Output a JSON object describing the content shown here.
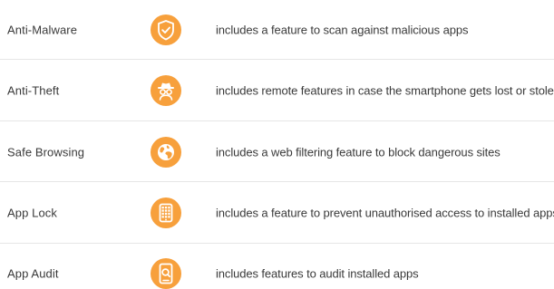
{
  "features": [
    {
      "name": "Anti-Malware",
      "icon": "shield-check-icon",
      "description": "includes a feature to scan against malicious apps"
    },
    {
      "name": "Anti-Theft",
      "icon": "incognito-spy-icon",
      "description": "includes remote features in case the smartphone gets lost or stolen"
    },
    {
      "name": "Safe Browsing",
      "icon": "globe-icon",
      "description": "includes a web filtering feature to block dangerous sites"
    },
    {
      "name": "App Lock",
      "icon": "phone-lock-icon",
      "description": "includes a feature to prevent unauthorised access to installed apps"
    },
    {
      "name": "App Audit",
      "icon": "phone-search-icon",
      "description": "includes features to audit installed apps"
    }
  ],
  "colors": {
    "icon_background": "#f7a03c",
    "text": "#3a3a3a",
    "divider": "#e6e6e6"
  }
}
